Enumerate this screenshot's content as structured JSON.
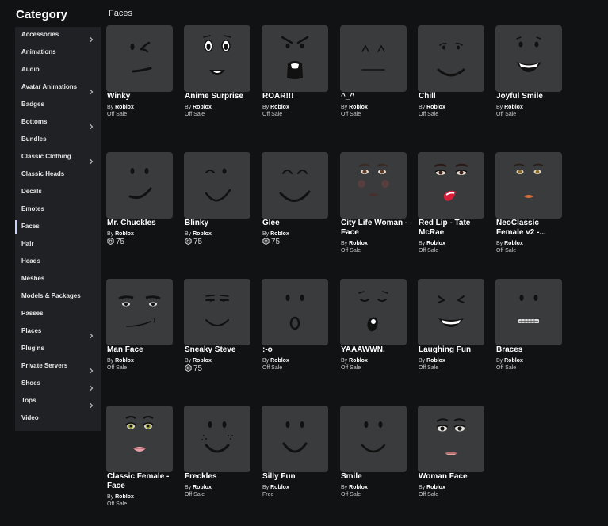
{
  "sidebar": {
    "title": "Category",
    "items": [
      {
        "label": "Accessories",
        "chevron": true
      },
      {
        "label": "Animations",
        "chevron": false
      },
      {
        "label": "Audio",
        "chevron": false
      },
      {
        "label": "Avatar Animations",
        "chevron": true
      },
      {
        "label": "Badges",
        "chevron": false
      },
      {
        "label": "Bottoms",
        "chevron": true
      },
      {
        "label": "Bundles",
        "chevron": false
      },
      {
        "label": "Classic Clothing",
        "chevron": true
      },
      {
        "label": "Classic Heads",
        "chevron": false
      },
      {
        "label": "Decals",
        "chevron": false
      },
      {
        "label": "Emotes",
        "chevron": false
      },
      {
        "label": "Faces",
        "chevron": false,
        "active": true
      },
      {
        "label": "Hair",
        "chevron": false
      },
      {
        "label": "Heads",
        "chevron": false
      },
      {
        "label": "Meshes",
        "chevron": false
      },
      {
        "label": "Models & Packages",
        "chevron": false
      },
      {
        "label": "Passes",
        "chevron": false
      },
      {
        "label": "Places",
        "chevron": true
      },
      {
        "label": "Plugins",
        "chevron": false
      },
      {
        "label": "Private Servers",
        "chevron": true
      },
      {
        "label": "Shoes",
        "chevron": true
      },
      {
        "label": "Tops",
        "chevron": true
      },
      {
        "label": "Video",
        "chevron": false
      }
    ]
  },
  "main": {
    "heading": "Faces",
    "by_label": "By",
    "items": [
      {
        "name": "Winky",
        "creator": "Roblox",
        "price": "Off Sale",
        "face": "winky-face-icon"
      },
      {
        "name": "Anime Surprise",
        "creator": "Roblox",
        "price": "Off Sale",
        "face": "anime-surprise-face-icon"
      },
      {
        "name": "ROAR!!!",
        "creator": "Roblox",
        "price": "Off Sale",
        "face": "roar-face-icon"
      },
      {
        "name": "^_^",
        "creator": "Roblox",
        "price": "Off Sale",
        "face": "caret-face-icon"
      },
      {
        "name": "Chill",
        "creator": "Roblox",
        "price": "Off Sale",
        "face": "chill-face-icon"
      },
      {
        "name": "Joyful Smile",
        "creator": "Roblox",
        "price": "Off Sale",
        "face": "joyful-smile-face-icon"
      },
      {
        "name": "Mr. Chuckles",
        "creator": "Roblox",
        "price": "75",
        "robux": true,
        "face": "mr-chuckles-face-icon"
      },
      {
        "name": "Blinky",
        "creator": "Roblox",
        "price": "75",
        "robux": true,
        "face": "blinky-face-icon"
      },
      {
        "name": "Glee",
        "creator": "Roblox",
        "price": "75",
        "robux": true,
        "face": "glee-face-icon"
      },
      {
        "name": "City Life Woman - Face",
        "creator": "Roblox",
        "price": "Off Sale",
        "face": "city-life-woman-face-icon"
      },
      {
        "name": "Red Lip - Tate McRae",
        "creator": "Roblox",
        "price": "Off Sale",
        "face": "red-lip-face-icon"
      },
      {
        "name": "NeoClassic Female v2 -...",
        "creator": "Roblox",
        "price": "Off Sale",
        "face": "neoclassic-female-face-icon"
      },
      {
        "name": "Man Face",
        "creator": "Roblox",
        "price": "Off Sale",
        "face": "man-face-icon"
      },
      {
        "name": "Sneaky Steve",
        "creator": "Roblox",
        "price": "75",
        "robux": true,
        "face": "sneaky-steve-face-icon"
      },
      {
        "name": ":-o",
        "creator": "Roblox",
        "price": "Off Sale",
        "face": "surprised-o-face-icon"
      },
      {
        "name": "YAAAWWN.",
        "creator": "Roblox",
        "price": "Off Sale",
        "face": "yawn-face-icon"
      },
      {
        "name": "Laughing Fun",
        "creator": "Roblox",
        "price": "Off Sale",
        "face": "laughing-fun-face-icon"
      },
      {
        "name": "Braces",
        "creator": "Roblox",
        "price": "Off Sale",
        "face": "braces-face-icon"
      },
      {
        "name": "Classic Female - Face",
        "creator": "Roblox",
        "price": "Off Sale",
        "face": "classic-female-face-icon"
      },
      {
        "name": "Freckles",
        "creator": "Roblox",
        "price": "Off Sale",
        "face": "freckles-face-icon"
      },
      {
        "name": "Silly Fun",
        "creator": "Roblox",
        "price": "Free",
        "face": "silly-fun-face-icon"
      },
      {
        "name": "Smile",
        "creator": "Roblox",
        "price": "Off Sale",
        "face": "smile-face-icon"
      },
      {
        "name": "Woman Face",
        "creator": "Roblox",
        "price": "Off Sale",
        "face": "woman-face-icon"
      }
    ]
  },
  "colors": {
    "background": "#111214",
    "sidebar": "#1f2124",
    "thumb": "#393b3d",
    "active_indicator": "#c9d0ff",
    "lips": "#d94a5a"
  }
}
